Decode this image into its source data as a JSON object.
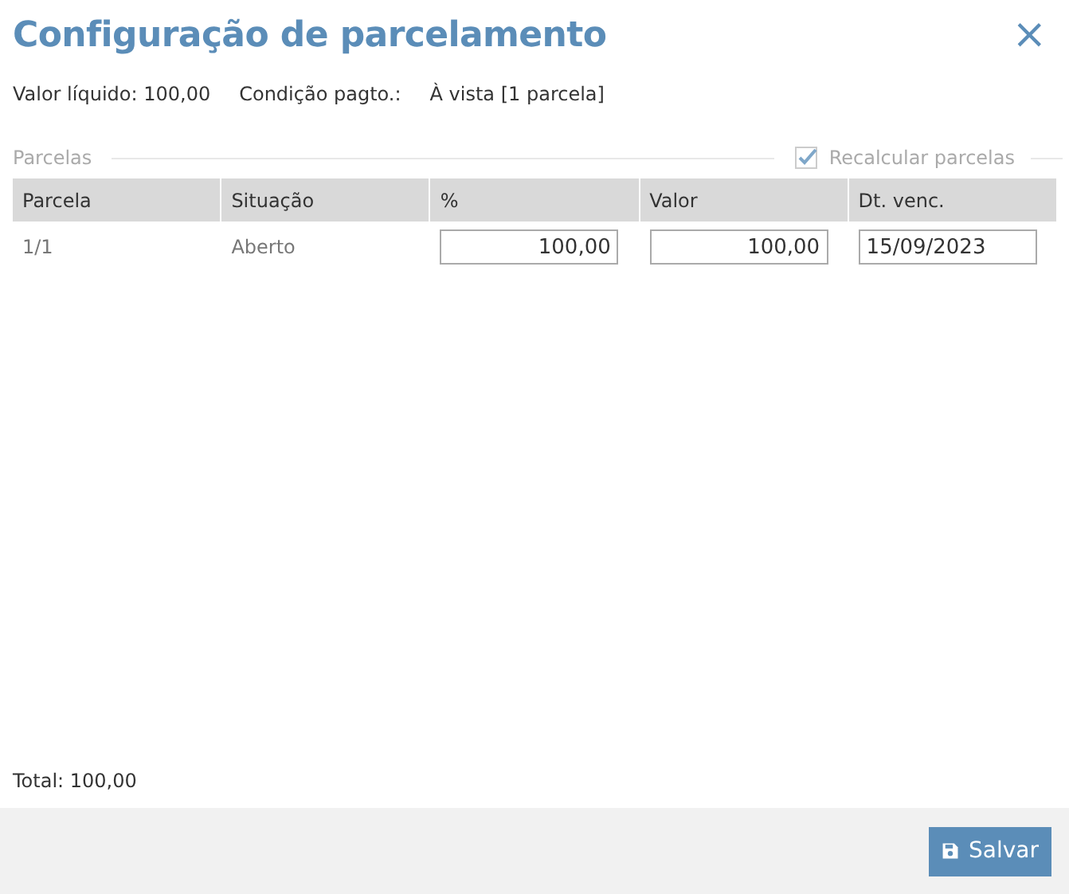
{
  "dialog": {
    "title": "Configuração de parcelamento",
    "close": "×"
  },
  "summary": {
    "net_value_label": "Valor líquido: 100,00",
    "payment_label": "Condição pagto.:",
    "payment_value": "À vista [1 parcela]"
  },
  "section": {
    "title": "Parcelas",
    "recalculate": {
      "label": "Recalcular parcelas",
      "checked": true
    }
  },
  "table": {
    "columns": [
      "Parcela",
      "Situação",
      "%",
      "Valor",
      "Dt. venc."
    ],
    "rows": [
      {
        "parcela": "1/1",
        "situacao": "Aberto",
        "percent": "100,00",
        "valor": "100,00",
        "vencimento": "15/09/2023"
      }
    ]
  },
  "total": "Total: 100,00",
  "footer": {
    "save_button": "Salvar"
  }
}
